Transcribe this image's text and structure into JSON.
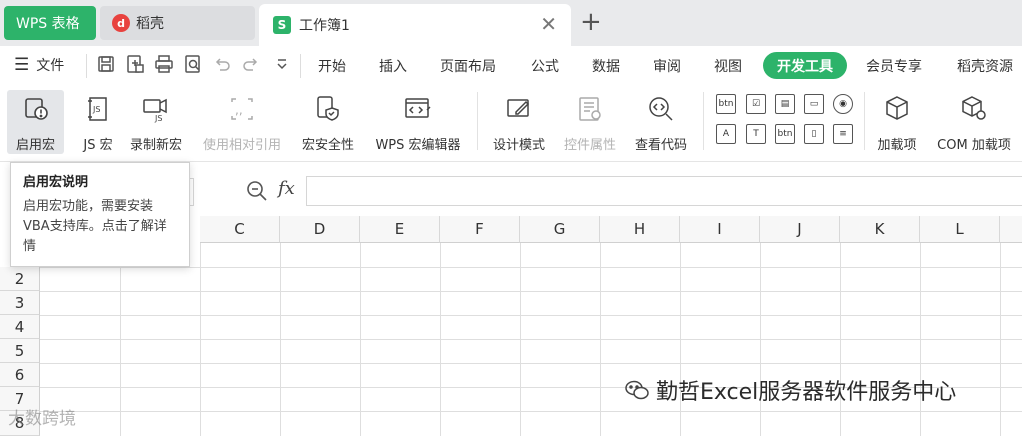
{
  "tabs": {
    "wps": "WPS 表格",
    "daoke": "稻壳",
    "workbook": "工作簿1",
    "workbook_icon": "S"
  },
  "menu": {
    "file": "文件",
    "items": [
      "开始",
      "插入",
      "页面布局",
      "公式",
      "数据",
      "审阅",
      "视图",
      "开发工具",
      "会员专享",
      "稻壳资源"
    ],
    "active": "开发工具"
  },
  "ribbon": {
    "enable_macro": "启用宏",
    "js_macro": "JS 宏",
    "record_macro": "录制新宏",
    "relative_ref": "使用相对引用",
    "macro_security": "宏安全性",
    "wps_macro_editor": "WPS 宏编辑器",
    "design_mode": "设计模式",
    "control_props": "控件属性",
    "view_code": "查看代码",
    "addins": "加载项",
    "com_addins": "COM 加载项"
  },
  "controls": [
    "btn",
    "☑",
    "▤",
    "▭",
    "◉",
    "A",
    "T",
    "btn",
    "▯",
    "≡"
  ],
  "formula": {
    "fx": "fx"
  },
  "columns": [
    "C",
    "D",
    "E",
    "F",
    "G",
    "H",
    "I",
    "J",
    "K",
    "L"
  ],
  "rows": [
    "2",
    "3",
    "4",
    "5",
    "6",
    "7",
    "8"
  ],
  "tooltip": {
    "title": "启用宏说明",
    "body": "启用宏功能，需要安装VBA支持库。点击了解详情"
  },
  "watermark": {
    "right": "勤哲Excel服务器软件服务中心",
    "left": "大数跨境"
  },
  "colors": {
    "accent": "#2db36a",
    "daoke_red": "#e8423f"
  }
}
